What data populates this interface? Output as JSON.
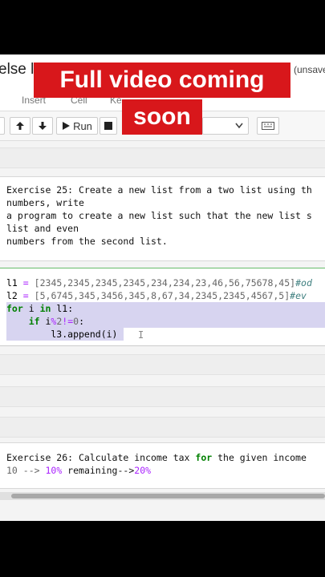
{
  "notebook": {
    "title": "else lo",
    "status": "(unsave"
  },
  "menu": [
    "Insert",
    "Cell",
    "Ke"
  ],
  "toolbar": {
    "up_icon": "arrow-up-icon",
    "down_icon": "arrow-down-icon",
    "run_label": "Run",
    "stop_icon": "stop-icon",
    "dropdown_icon": "chevron-down-icon",
    "keyboard_icon": "keyboard-icon"
  },
  "cells": {
    "exercise25": [
      "Exercise 25: Create a new list from a two list using th",
      "numbers, write",
      "a program to create a new list such that the new list s",
      "list and even",
      "numbers from the second list."
    ],
    "code": {
      "l1_name": "l1",
      "l1_value": "[2345,2345,2345,2345,234,234,23,46,56,75678,45]",
      "l1_comment": "#od",
      "l2_name": "l2",
      "l2_value": "[5,6745,345,3456,345,8,67,34,2345,2345,4567,5]",
      "l2_comment": "#ev",
      "for_kw": "for",
      "for_var": " i ",
      "in_kw": "in",
      "for_rest": " l1:",
      "if_indent": "    ",
      "if_kw": "if",
      "if_var": " i",
      "if_op": "%",
      "if_num": "2",
      "if_op2": "!=",
      "if_num2": "0",
      "if_colon": ":",
      "append_line": "        l3.append(i)"
    },
    "exercise26": {
      "prefix": "Exercise 26: Calculate income tax ",
      "kw": "for",
      "suffix": " the given income",
      "line2_a": "10 --> ",
      "line2_b": "10%",
      "line2_c": " remaining-->",
      "line2_d": "20%"
    }
  },
  "overlay": {
    "line1": "Full video coming",
    "line2": "soon",
    "color": "#d8171b"
  }
}
